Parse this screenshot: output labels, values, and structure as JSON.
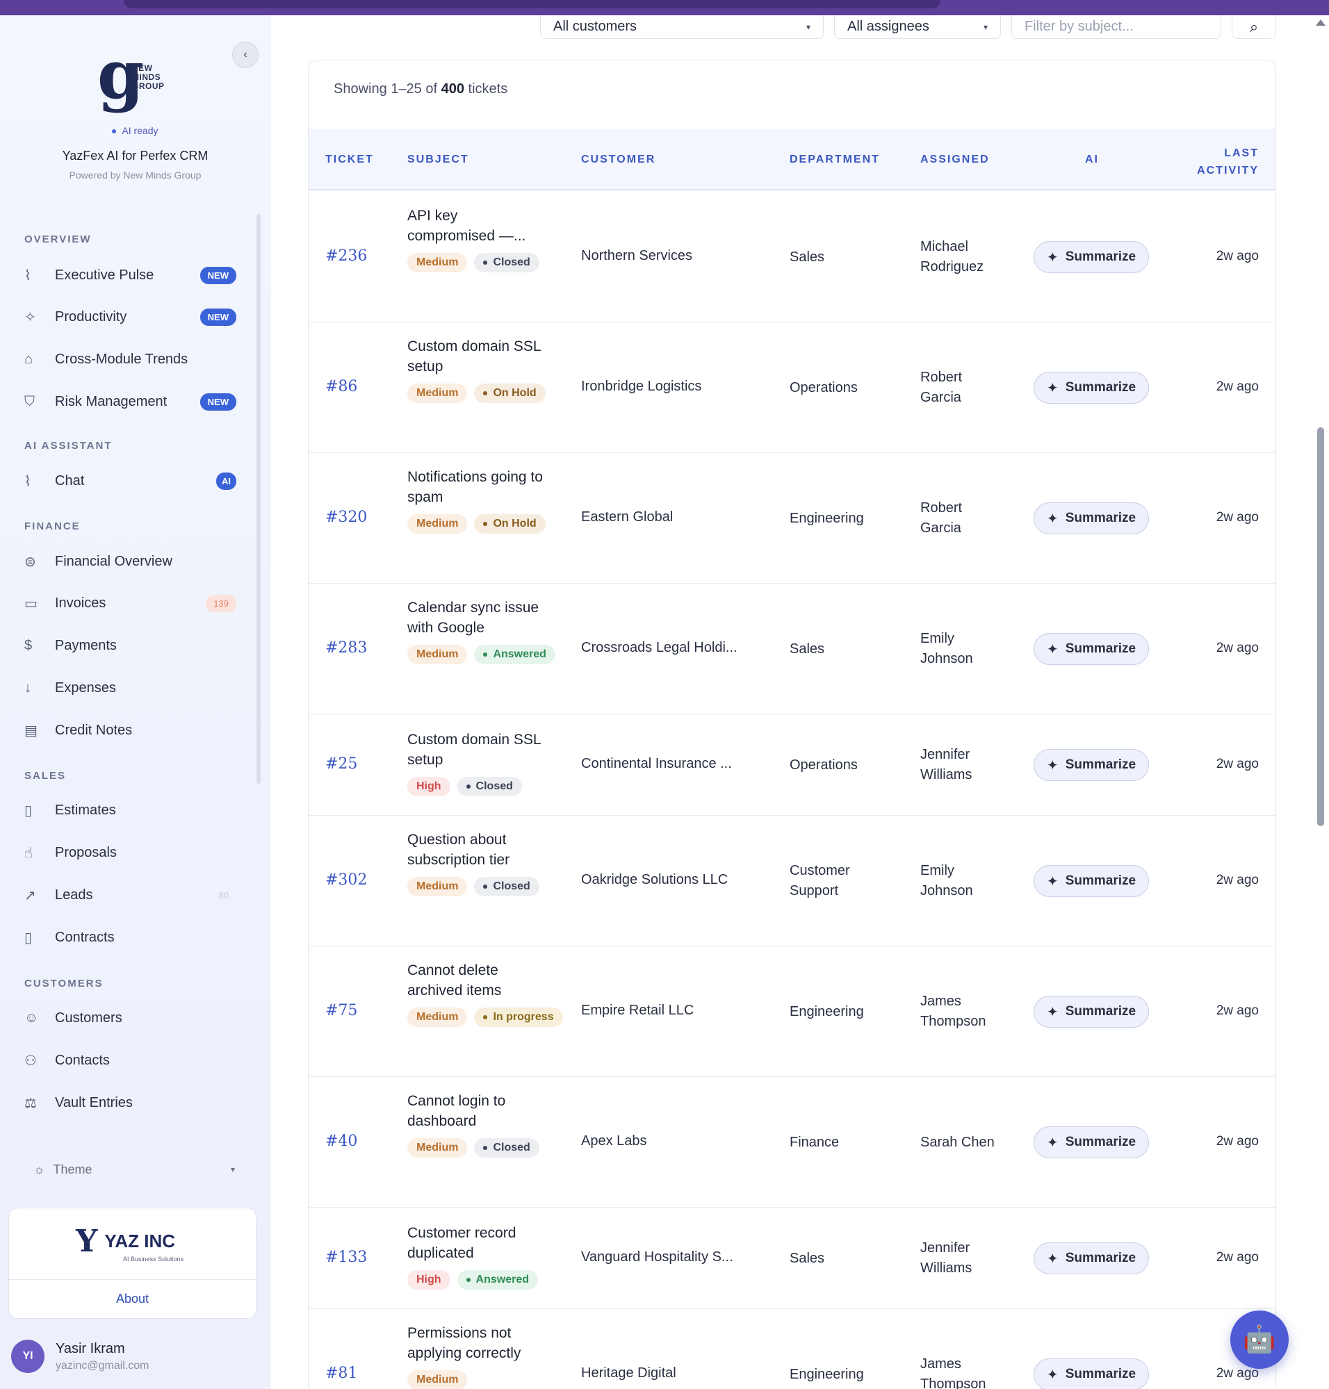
{
  "sidebar": {
    "logo_text": "NEW MINDS GROUP",
    "ai_status": "AI ready",
    "app_title": "YazFex AI for Perfex CRM",
    "app_subtitle": "Powered by New Minds Group",
    "sections": {
      "overview": "OVERVIEW",
      "ai_assistant": "AI ASSISTANT",
      "finance": "FINANCE",
      "sales": "SALES",
      "customers": "CUSTOMERS"
    },
    "items": {
      "executive_pulse": {
        "label": "Executive Pulse",
        "badge": "NEW",
        "icon": "pulse-icon"
      },
      "productivity": {
        "label": "Productivity",
        "badge": "NEW",
        "icon": "sparkle-icon"
      },
      "cross_module": {
        "label": "Cross-Module Trends",
        "icon": "home-icon"
      },
      "risk": {
        "label": "Risk Management",
        "badge": "NEW",
        "icon": "shield-icon"
      },
      "chat": {
        "label": "Chat",
        "badge": "AI",
        "icon": "pulse-icon"
      },
      "financial_overview": {
        "label": "Financial Overview",
        "icon": "dollar-icon"
      },
      "invoices": {
        "label": "Invoices",
        "badge": "139",
        "icon": "clipboard-icon"
      },
      "payments": {
        "label": "Payments",
        "icon": "dollar-small-icon"
      },
      "expenses": {
        "label": "Expenses",
        "icon": "arrow-down-icon"
      },
      "credit_notes": {
        "label": "Credit Notes",
        "icon": "note-icon"
      },
      "estimates": {
        "label": "Estimates",
        "icon": "document-icon"
      },
      "proposals": {
        "label": "Proposals",
        "icon": "thumbs-up-icon"
      },
      "leads": {
        "label": "Leads",
        "badge": "80",
        "icon": "trend-icon"
      },
      "contracts": {
        "label": "Contracts",
        "icon": "contract-icon"
      },
      "customers": {
        "label": "Customers",
        "icon": "user-icon"
      },
      "contacts": {
        "label": "Contacts",
        "icon": "contacts-icon"
      },
      "vault": {
        "label": "Vault Entries",
        "icon": "scale-icon"
      }
    },
    "theme_label": "Theme",
    "company": {
      "name": "YAZ INC",
      "tagline": "AI Business Solutions",
      "about": "About"
    },
    "user": {
      "initials": "YI",
      "name": "Yasir Ikram",
      "email": "yazinc@gmail.com"
    }
  },
  "filters": {
    "customer": "All customers",
    "assignee": "All assignees",
    "subject_placeholder": "Filter by subject..."
  },
  "table": {
    "showing_prefix": "Showing 1–25 of",
    "showing_total": "400",
    "showing_suffix": "tickets",
    "headers": {
      "ticket": "TICKET",
      "subject": "SUBJECT",
      "customer": "CUSTOMER",
      "department": "DEPARTMENT",
      "assigned": "ASSIGNED",
      "ai": "AI",
      "last_activity_1": "LAST",
      "last_activity_2": "ACTIVITY"
    },
    "summarize_label": "Summarize",
    "rows": [
      {
        "id": "#236",
        "subject": "API key compromised —...",
        "priority": "Medium",
        "status": "Closed",
        "customer": "Northern Services",
        "department": "Sales",
        "assigned": "Michael Rodriguez",
        "activity": "2w ago"
      },
      {
        "id": "#86",
        "subject": "Custom domain SSL setup",
        "priority": "Medium",
        "status": "On Hold",
        "customer": "Ironbridge Logistics",
        "department": "Operations",
        "assigned": "Robert Garcia",
        "activity": "2w ago"
      },
      {
        "id": "#320",
        "subject": "Notifications going to spam",
        "priority": "Medium",
        "status": "On Hold",
        "customer": "Eastern Global",
        "department": "Engineering",
        "assigned": "Robert Garcia",
        "activity": "2w ago"
      },
      {
        "id": "#283",
        "subject": "Calendar sync issue with Google",
        "priority": "Medium",
        "status": "Answered",
        "customer": "Crossroads Legal Holdi...",
        "department": "Sales",
        "assigned": "Emily Johnson",
        "activity": "2w ago"
      },
      {
        "id": "#25",
        "subject": "Custom domain SSL setup",
        "priority": "High",
        "status": "Closed",
        "customer": "Continental Insurance ...",
        "department": "Operations",
        "assigned": "Jennifer Williams",
        "activity": "2w ago"
      },
      {
        "id": "#302",
        "subject": "Question about subscription tier",
        "priority": "Medium",
        "status": "Closed",
        "customer": "Oakridge Solutions LLC",
        "department": "Customer Support",
        "assigned": "Emily Johnson",
        "activity": "2w ago"
      },
      {
        "id": "#75",
        "subject": "Cannot delete archived items",
        "priority": "Medium",
        "status": "In progress",
        "customer": "Empire Retail LLC",
        "department": "Engineering",
        "assigned": "James Thompson",
        "activity": "2w ago"
      },
      {
        "id": "#40",
        "subject": "Cannot login to dashboard",
        "priority": "Medium",
        "status": "Closed",
        "customer": "Apex Labs",
        "department": "Finance",
        "assigned": "Sarah Chen",
        "activity": "2w ago"
      },
      {
        "id": "#133",
        "subject": "Customer record duplicated",
        "priority": "High",
        "status": "Answered",
        "customer": "Vanguard Hospitality S...",
        "department": "Sales",
        "assigned": "Jennifer Williams",
        "activity": "2w ago"
      },
      {
        "id": "#81",
        "subject": "Permissions not applying correctly",
        "priority": "Medium",
        "status": "",
        "customer": "Heritage Digital",
        "department": "Engineering",
        "assigned": "James Thompson",
        "activity": "2w ago"
      }
    ]
  }
}
